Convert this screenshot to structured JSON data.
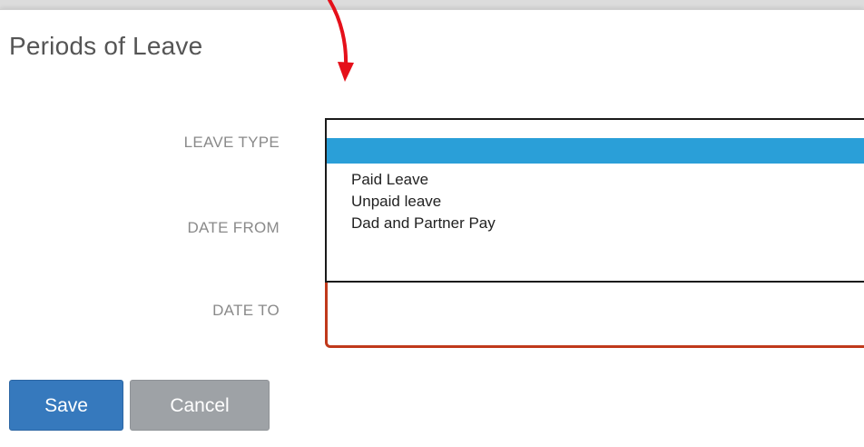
{
  "form": {
    "title": "Periods of Leave",
    "labels": {
      "leave_type": "LEAVE TYPE",
      "date_from": "DATE FROM",
      "date_to": "DATE TO"
    },
    "leave_type_dropdown": {
      "options": [
        "",
        "Paid Leave",
        "Unpaid leave",
        "Dad and Partner Pay"
      ],
      "highlighted_index": 0
    },
    "date_to_value": ""
  },
  "actions": {
    "save_label": "Save",
    "cancel_label": "Cancel"
  },
  "annotation": {
    "arrow_color": "#e5101a"
  },
  "colors": {
    "highlight": "#2a9fd8",
    "save_button": "#3679bd",
    "cancel_button": "#9ea2a6",
    "error_border": "#c0391b"
  }
}
